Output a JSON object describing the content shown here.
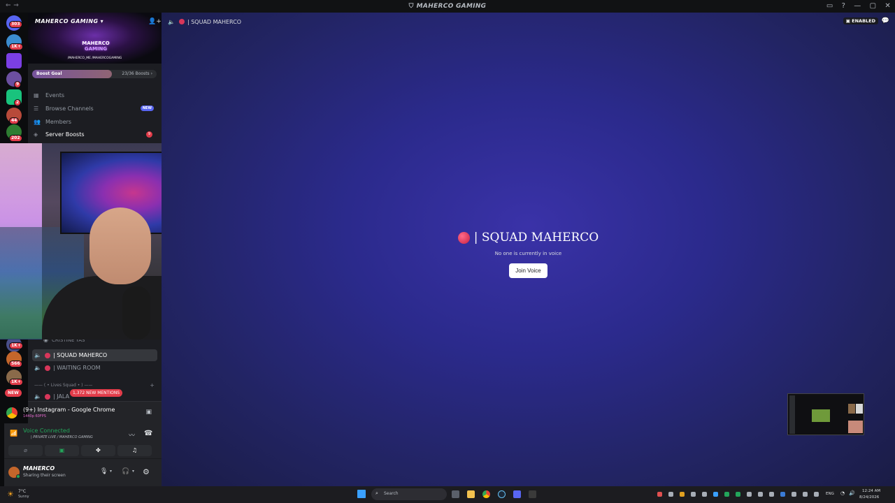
{
  "window": {
    "title": "MAHERCO GAMING",
    "nav": "←  →",
    "controls": [
      "▭",
      "?",
      "—",
      "▢",
      "✕"
    ]
  },
  "guilds": [
    {
      "badge": "303",
      "color": "#5865f2"
    },
    {
      "badge": "1K+",
      "color": "#3c8dd0"
    },
    {
      "badge": "",
      "color": "#7b3fe4"
    },
    {
      "badge": "9",
      "color": "#6b4fa0"
    },
    {
      "badge": "2",
      "color": "#19c37d"
    },
    {
      "badge": "44",
      "color": "#b84a3a"
    },
    {
      "badge": "202",
      "color": "#2e7d32"
    }
  ],
  "server": {
    "name": "MAHERCO GAMING",
    "logo_line1": "MAHERCO",
    "logo_line2": "GAMING",
    "handles": "/MAHERCO_ME  /MAHERCOGAMING",
    "boost_label": "Boost Goal",
    "boost_count": "23/36 Boosts",
    "boost_progress": 0.64,
    "menu": {
      "events": "Events",
      "browse": "Browse Channels",
      "browse_badge": "NEW",
      "members": "Members",
      "boosts": "Server Boosts",
      "boosts_count": "9"
    }
  },
  "channels": {
    "partial_top": "CRISTINE YAS",
    "squad": "| SQUAD MAHERCO",
    "waiting": "| WAITING ROOM",
    "category": "—— ( • Lives Squad • ) ——",
    "jala": "| JALA",
    "mentions": "1,372 NEW MENTIONS",
    "new_pill": "NEW"
  },
  "left_badges": {
    "b1": "1K+",
    "b2": "566",
    "b3": "1K+"
  },
  "stream": {
    "title": "(9+) Instagram - Google Chrome",
    "quality": "1440p 60FPS"
  },
  "voice": {
    "status": "Voice Connected",
    "channel": "| PRIVATE LIVE / MAHERCO GAMING"
  },
  "user": {
    "name": "MAHERCO",
    "status": "Sharing their screen"
  },
  "header": {
    "channel": "| SQUAD MAHERCO",
    "badge": "ENABLED"
  },
  "center": {
    "title": "| SQUAD MAHERCO",
    "subtitle": "No one is currently in voice",
    "join": "Join Voice"
  },
  "taskbar": {
    "weather_temp": "7°C",
    "weather_desc": "Sunny",
    "search": "Search",
    "lang": "ENG",
    "time": "12:24 AM",
    "date": "8/24/2026"
  },
  "colors": {
    "accent": "#5865f2",
    "danger": "#e23c4a",
    "online": "#23a55a"
  }
}
